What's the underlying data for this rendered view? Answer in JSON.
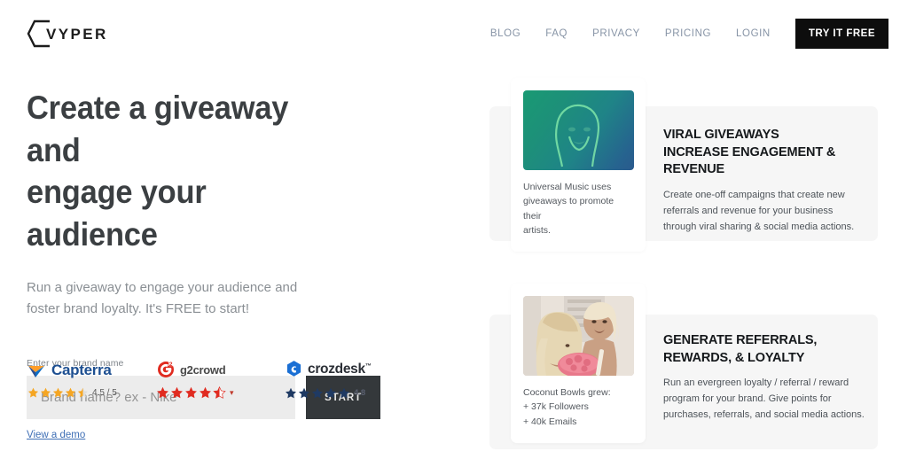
{
  "brand": {
    "logo_text": "VYPER",
    "logo_icon": "hexagon-bracket-icon"
  },
  "nav": {
    "links": [
      {
        "label": "BLOG"
      },
      {
        "label": "FAQ"
      },
      {
        "label": "PRIVACY"
      },
      {
        "label": "PRICING"
      },
      {
        "label": "LOGIN"
      }
    ],
    "cta_label": "TRY IT FREE",
    "cta_color": "#0d0d0d",
    "link_color": "#8794a6"
  },
  "hero": {
    "title_line1": "Create a giveaway and",
    "title_line2": "engage your audience",
    "subtitle_line1": "Run a giveaway to engage your audience and",
    "subtitle_line2": "foster brand loyalty. It's FREE to start!",
    "title_color": "#3b3f42",
    "subtitle_color": "#8a8f94"
  },
  "form": {
    "label": "Enter your brand name",
    "placeholder": "Brand name? ex - Nike",
    "value": "",
    "submit_label": "START",
    "submit_color": "#34383b",
    "demo_link_label": "View a demo",
    "demo_link_color": "#3f6fb5"
  },
  "badges": [
    {
      "name": "Capterra",
      "logo_icon": "capterra-arrow-icon",
      "stars_filled": 4,
      "stars_half": 1,
      "stars_total": 5,
      "star_color": "#f5a623",
      "score": "4.5 / 5",
      "has_chevron": false
    },
    {
      "name": "g2crowd",
      "logo_icon": "g2crowd-circle-icon",
      "stars_filled": 4,
      "stars_half": 1,
      "stars_total": 5,
      "star_color": "#e02b20",
      "score": "",
      "has_chevron": true
    },
    {
      "name": "crozdesk",
      "logo_icon": "crozdesk-hexagon-icon",
      "stars_filled": 5,
      "stars_half": 0,
      "stars_total": 5,
      "star_color": "#1f3a63",
      "score": "4.8",
      "has_chevron": false
    }
  ],
  "features": [
    {
      "thumbnail_alt": "universal-music-artist-portrait",
      "caption_line1": "Universal Music uses",
      "caption_line2": "giveaways to promote their",
      "caption_line3": "artists.",
      "title_line1": "VIRAL GIVEAWAYS",
      "title_line2": "INCREASE ENGAGEMENT &",
      "title_line3": "REVENUE",
      "body_line1": "Create one-off campaigns that create new",
      "body_line2": "referrals and revenue for your business",
      "body_line3": "through viral sharing & social media actions."
    },
    {
      "thumbnail_alt": "coconut-bowls-customers-photo",
      "caption_line1": "Coconut Bowls grew:",
      "caption_line2": "+ 37k Followers",
      "caption_line3": "+ 40k Emails",
      "title_line1": "GENERATE REFERRALS,",
      "title_line2": "REWARDS, & LOYALTY",
      "title_line3": "",
      "body_line1": "Run an evergreen loyalty / referral / reward",
      "body_line2": "program for your brand. Give points for",
      "body_line3": "purchases, referrals, and social media actions."
    }
  ]
}
